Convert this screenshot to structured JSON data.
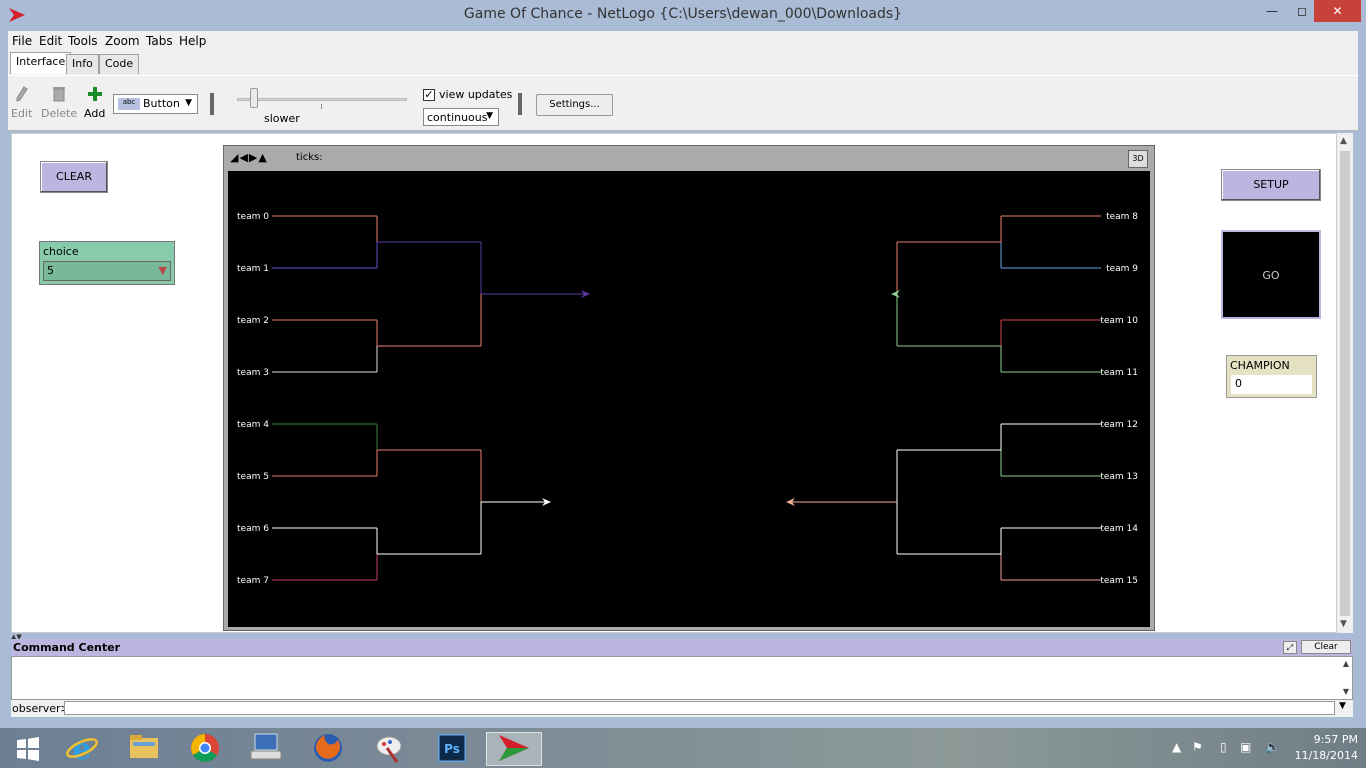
{
  "window": {
    "title": "Game Of Chance - NetLogo {C:\\Users\\dewan_000\\Downloads}"
  },
  "menu": [
    "File",
    "Edit",
    "Tools",
    "Zoom",
    "Tabs",
    "Help"
  ],
  "tabs": [
    {
      "label": "Interface",
      "active": true
    },
    {
      "label": "Info",
      "active": false
    },
    {
      "label": "Code",
      "active": false
    }
  ],
  "toolbar": {
    "edit_label": "Edit",
    "delete_label": "Delete",
    "add_label": "Add",
    "widget_type": "Button",
    "widget_icon_text": "abc",
    "speed_label": "slower",
    "view_updates_label": "view updates",
    "view_updates_checked": true,
    "update_mode": "continuous",
    "settings_label": "Settings..."
  },
  "interface": {
    "clear_button": "CLEAR",
    "setup_button": "SETUP",
    "go_button": "GO",
    "chooser": {
      "label": "choice",
      "value": "5"
    },
    "monitor": {
      "label": "CHAMPION",
      "value": "0"
    }
  },
  "view": {
    "ticks_label": "ticks:",
    "three_d_label": "3D",
    "teams": [
      "team 0",
      "team 1",
      "team 2",
      "team 3",
      "team 4",
      "team 5",
      "team 6",
      "team 7",
      "team 8",
      "team 9",
      "team 10",
      "team 11",
      "team 12",
      "team 13",
      "team 14",
      "team 15"
    ],
    "colors": {
      "team0": "#e8806e",
      "team1": "#5c55c8",
      "team2": "#e8806e",
      "team3": "#e0e0f0",
      "team4": "#3f7f3f",
      "team5": "#e8806e",
      "team6": "#ffffff",
      "team7": "#c0405a",
      "team8": "#e8806e",
      "team9": "#6aa6e0",
      "team10": "#d04848",
      "team11": "#8fd08f",
      "team12": "#ffffff",
      "team13": "#8fd08f",
      "team14": "#ffffff",
      "team15": "#f0a0a0",
      "semi_l_top": "#5a3aa0",
      "semi_l_bottom": "#e8806e",
      "semi_r_top": "#e8806e",
      "semi_r_bottom": "#8fd08f",
      "semi_l_lower_top": "#e8806e",
      "semi_l_lower_bottom": "#ffffff",
      "semi_r_lower_top": "#ffffff",
      "semi_r_lower_bottom": "#ffffff",
      "final_l_top": "#5a3aa0",
      "final_l_bottom": "#ffffff",
      "final_r_top": "#8fd08f",
      "final_r_bottom": "#f0b090"
    }
  },
  "command_center": {
    "title": "Command Center",
    "clear_label": "Clear",
    "prompt": "observer>"
  },
  "taskbar": {
    "time": "9:57 PM",
    "date": "11/18/2014",
    "apps": [
      "start-icon",
      "internet-explorer-icon",
      "file-explorer-icon",
      "chrome-icon",
      "keyboard-icon",
      "firefox-icon",
      "paint-icon",
      "photoshop-icon",
      "netlogo-icon"
    ]
  }
}
